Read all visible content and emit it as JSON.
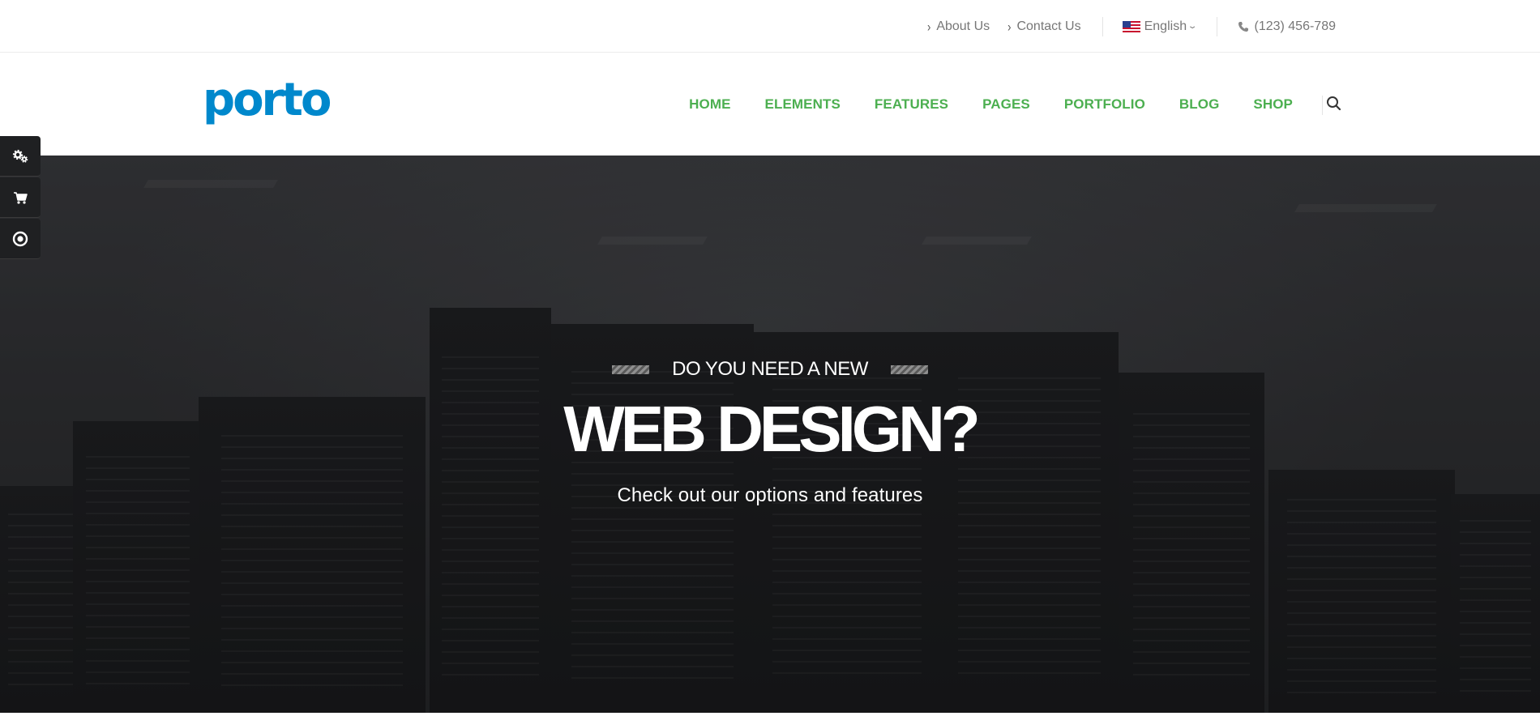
{
  "topbar": {
    "links": [
      {
        "label": "About Us"
      },
      {
        "label": "Contact Us"
      }
    ],
    "language": "English",
    "phone": "(123) 456-789"
  },
  "header": {
    "logo": "porto",
    "nav": [
      {
        "label": "HOME"
      },
      {
        "label": "ELEMENTS"
      },
      {
        "label": "FEATURES"
      },
      {
        "label": "PAGES"
      },
      {
        "label": "PORTFOLIO"
      },
      {
        "label": "BLOG"
      },
      {
        "label": "SHOP"
      }
    ]
  },
  "side_widget": {
    "icons": [
      "gears-icon",
      "cart-icon",
      "target-icon"
    ]
  },
  "hero": {
    "eyebrow": "DO YOU NEED A NEW",
    "headline": "WEB DESIGN?",
    "tagline": "Check out our options and features"
  },
  "colors": {
    "brand": "#0088cc",
    "nav": "#4caf50",
    "hero_text": "#ffffff"
  }
}
